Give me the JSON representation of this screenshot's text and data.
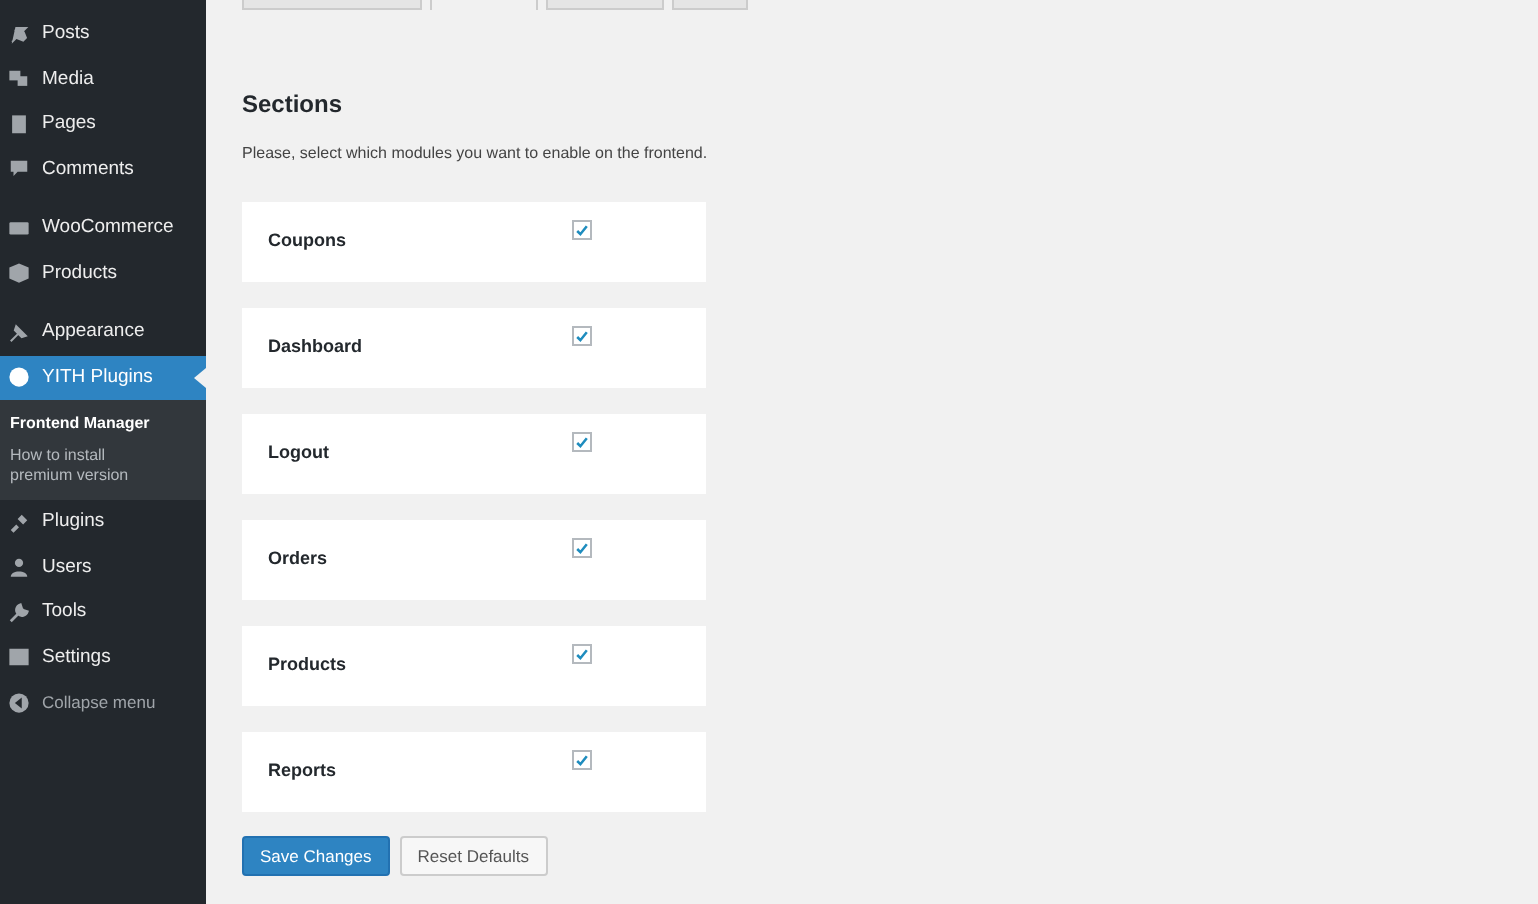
{
  "sidebar": {
    "groups": [
      [
        {
          "label": "Posts",
          "selected": false
        },
        {
          "label": "Media",
          "selected": false
        },
        {
          "label": "Pages",
          "selected": false
        },
        {
          "label": "Comments",
          "selected": false
        }
      ],
      [
        {
          "label": "WooCommerce",
          "selected": false
        },
        {
          "label": "Products",
          "selected": false
        }
      ],
      [
        {
          "label": "Appearance",
          "selected": false
        },
        {
          "label": "YITH Plugins",
          "selected": true,
          "submenu": [
            {
              "label": "Frontend Manager",
              "selected": true
            },
            {
              "label": "How to install premium version",
              "selected": false
            }
          ]
        },
        {
          "label": "Plugins",
          "selected": false
        },
        {
          "label": "Users",
          "selected": false
        },
        {
          "label": "Tools",
          "selected": false
        },
        {
          "label": "Settings",
          "selected": false
        }
      ]
    ],
    "collapse": "Collapse menu"
  },
  "tabs": [
    {
      "selected": false
    },
    {
      "selected": true
    },
    {
      "selected": false
    },
    {
      "selected": false
    }
  ],
  "section": {
    "title": "Sections",
    "description": "Please, select which modules you want to enable on the frontend.",
    "modules": [
      {
        "label": "Coupons",
        "checked": true
      },
      {
        "label": "Dashboard",
        "checked": true
      },
      {
        "label": "Logout",
        "checked": true
      },
      {
        "label": "Orders",
        "checked": true
      },
      {
        "label": "Products",
        "checked": true
      },
      {
        "label": "Reports",
        "checked": true
      }
    ]
  },
  "buttons": [
    {
      "label": "Save Changes",
      "kind": "primary"
    },
    {
      "label": "Reset Defaults",
      "kind": "secondary"
    }
  ]
}
